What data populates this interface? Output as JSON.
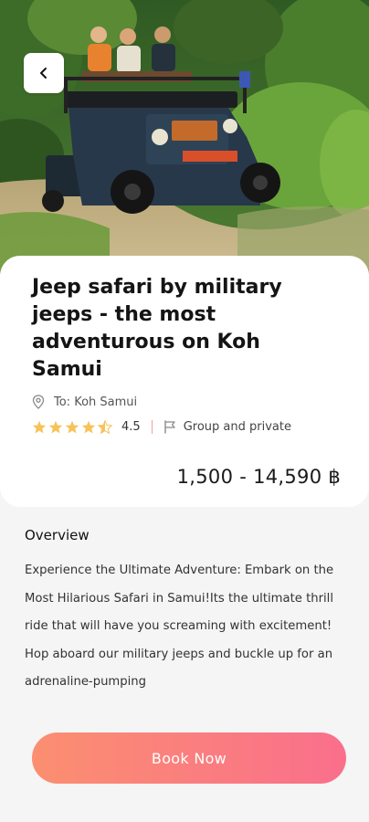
{
  "tour": {
    "title": "Jeep safari by military jeeps - the most adventurous on Koh Samui",
    "location": "To: Koh Samui",
    "rating": "4.5",
    "rating_stars": 4.5,
    "tour_type": "Group and private",
    "price": "1,500 - 14,590 ฿"
  },
  "overview": {
    "heading": "Overview",
    "text": "Experience the Ultimate Adventure: Embark on the Most Hilarious Safari in Samui!Its the ultimate thrill ride that will have you screaming with excitement! Hop aboard our military jeeps and buckle up for an adrenaline-pumping"
  },
  "actions": {
    "book_label": "Book Now"
  },
  "icons": {
    "back": "chevron-left-icon",
    "location": "map-pin-icon",
    "star": "star-icon",
    "tour_type": "flag-icon"
  },
  "colors": {
    "star": "#f6c35a",
    "button_gradient_start": "#fb8f70",
    "button_gradient_end": "#fa6f8c",
    "divider": "#f1a0a0"
  }
}
